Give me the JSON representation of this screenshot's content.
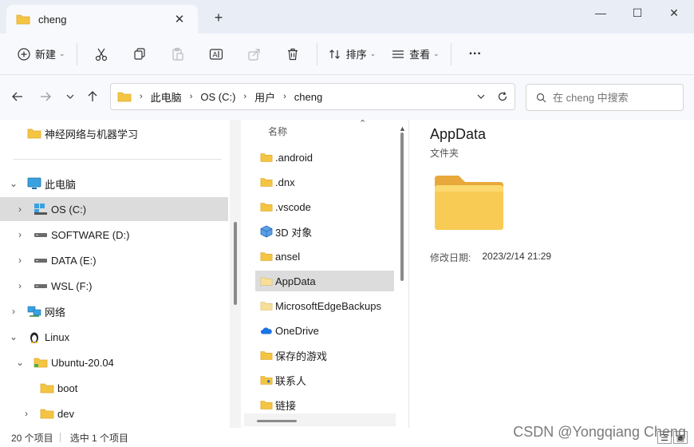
{
  "tab": {
    "title": "cheng",
    "close_glyph": "✕"
  },
  "new_tab_glyph": "+",
  "window_controls": {
    "minimize_glyph": "—",
    "maximize_glyph": "☐",
    "close_glyph": "✕"
  },
  "toolbar": {
    "new_label": "新建",
    "sort_label": "排序",
    "view_label": "查看",
    "more_glyph": "···"
  },
  "address": {
    "crumbs": [
      "此电脑",
      "OS (C:)",
      "用户",
      "cheng"
    ],
    "search_placeholder": "在 cheng 中搜索"
  },
  "nav": {
    "quick_item": "神经网络与机器学习",
    "items": [
      {
        "label": "此电脑",
        "icon": "pc-icon"
      },
      {
        "label": "OS (C:)",
        "icon": "os-drive-icon"
      },
      {
        "label": "SOFTWARE (D:)",
        "icon": "drive-icon"
      },
      {
        "label": "DATA (E:)",
        "icon": "drive-icon"
      },
      {
        "label": "WSL (F:)",
        "icon": "drive-icon"
      },
      {
        "label": "网络",
        "icon": "network-icon"
      },
      {
        "label": "Linux",
        "icon": "linux-icon"
      },
      {
        "label": "Ubuntu-20.04",
        "icon": "folder-icon"
      },
      {
        "label": "boot",
        "icon": "folder-icon"
      },
      {
        "label": "dev",
        "icon": "folder-icon"
      }
    ]
  },
  "files": {
    "column_header": "名称",
    "items": [
      {
        "name": ".android",
        "icon": "folder-icon"
      },
      {
        "name": ".dnx",
        "icon": "folder-icon"
      },
      {
        "name": ".vscode",
        "icon": "folder-icon"
      },
      {
        "name": "3D 对象",
        "icon": "3d-objects-icon"
      },
      {
        "name": "ansel",
        "icon": "folder-icon"
      },
      {
        "name": "AppData",
        "icon": "folder-icon"
      },
      {
        "name": "MicrosoftEdgeBackups",
        "icon": "folder-icon"
      },
      {
        "name": "OneDrive",
        "icon": "onedrive-icon"
      },
      {
        "name": "保存的游戏",
        "icon": "folder-icon"
      },
      {
        "name": "联系人",
        "icon": "contacts-icon"
      },
      {
        "name": "链接",
        "icon": "links-icon"
      }
    ]
  },
  "details": {
    "title": "AppData",
    "type": "文件夹",
    "modified_label": "修改日期:",
    "modified_value": "2023/2/14 21:29"
  },
  "status": {
    "item_count": "20 个项目",
    "selected": "选中 1 个项目"
  },
  "watermark": "CSDN @Yongqiang Cheng",
  "colors": {
    "folder": "#f4c542",
    "folder_dark": "#e0a82e",
    "selection": "#dcdcdc",
    "titlebar": "#e9eef6",
    "toolbar": "#f7f9fc"
  }
}
